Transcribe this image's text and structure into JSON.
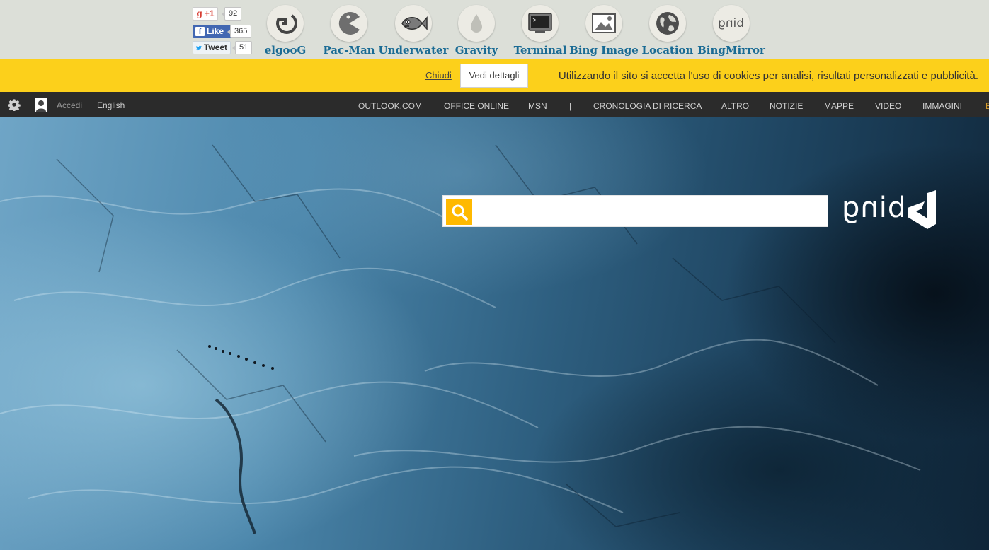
{
  "social": {
    "gplus_label": "+1",
    "gplus_count": "92",
    "facebook_label": "Like",
    "facebook_count": "365",
    "twitter_label": "Tweet",
    "twitter_count": "51"
  },
  "tools": [
    {
      "label": "elgooG",
      "icon": "elgoog-icon"
    },
    {
      "label": "Pac-Man",
      "icon": "pacman-icon"
    },
    {
      "label": "Underwater",
      "icon": "fish-icon"
    },
    {
      "label": "Gravity",
      "icon": "drop-icon"
    },
    {
      "label": "Terminal",
      "icon": "terminal-icon"
    },
    {
      "label": "Bing Image",
      "icon": "picture-icon"
    },
    {
      "label": "Location",
      "icon": "globe-icon"
    },
    {
      "label": "BingMirror",
      "icon": "bing-icon"
    }
  ],
  "cookie_banner": {
    "text": "Utilizzando il sito si accetta l'uso di cookies per analisi, risultati personalizzati e pubblicità.",
    "details_button": "Vedi dettagli",
    "close_link": "Chiudi"
  },
  "nav": {
    "items": [
      "IMMAGINI",
      "VIDEO",
      "MAPPE",
      "NOTIZIE",
      "ALTRO",
      "CRONOLOGIA DI RICERCA",
      "|",
      "MSN",
      "OFFICE ONLINE",
      "OUTLOOK.COM"
    ],
    "accent": "B",
    "language": "English",
    "sign_in": "Accedi"
  },
  "search": {
    "placeholder": "",
    "logo_text": "bing"
  },
  "colors": {
    "cookie_bg": "#fcd01b",
    "nav_bg": "#2b2b2b",
    "search_button": "#ffb900",
    "tool_label": "#1a6b94"
  }
}
